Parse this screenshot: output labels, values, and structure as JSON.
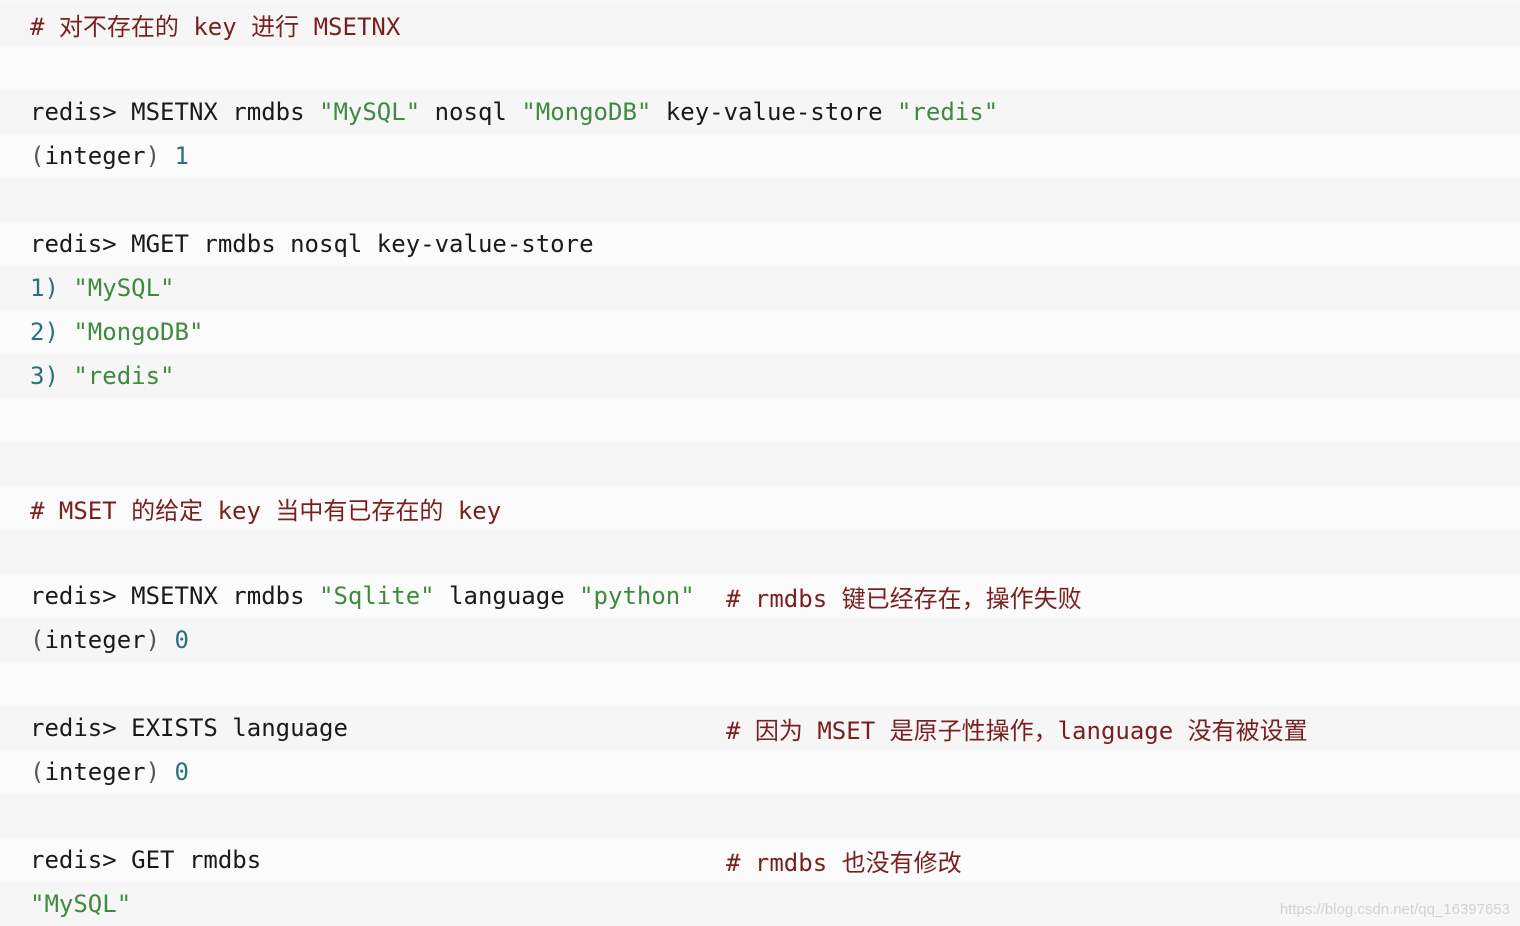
{
  "lines": {
    "l0": {
      "comment": "# 对不存在的 key 进行 MSETNX"
    },
    "l2": {
      "prompt": "redis> ",
      "cmd": "MSETNX rmdbs ",
      "s1": "\"MySQL\"",
      "m1": " nosql ",
      "s2": "\"MongoDB\"",
      "m2": " key-value-store ",
      "s3": "\"redis\""
    },
    "l3": {
      "lp": "(",
      "word": "integer",
      "rp": ")",
      "sp": " ",
      "num": "1"
    },
    "l5": {
      "prompt": "redis> ",
      "cmd": "MGET rmdbs nosql key-value-store"
    },
    "l6": {
      "idx": "1)",
      "sp": " ",
      "str": "\"MySQL\""
    },
    "l7": {
      "idx": "2)",
      "sp": " ",
      "str": "\"MongoDB\""
    },
    "l8": {
      "idx": "3)",
      "sp": " ",
      "str": "\"redis\""
    },
    "l11": {
      "comment": "# MSET 的给定 key 当中有已存在的 key"
    },
    "l13": {
      "prompt": "redis> ",
      "cmd": "MSETNX rmdbs ",
      "s1": "\"Sqlite\"",
      "m1": " language ",
      "s2": "\"python\"",
      "comment": "# rmdbs 键已经存在，操作失败"
    },
    "l14": {
      "lp": "(",
      "word": "integer",
      "rp": ")",
      "sp": " ",
      "num": "0"
    },
    "l16": {
      "prompt": "redis> ",
      "cmd": "EXISTS language",
      "comment": "# 因为 MSET 是原子性操作，language 没有被设置"
    },
    "l17": {
      "lp": "(",
      "word": "integer",
      "rp": ")",
      "sp": " ",
      "num": "0"
    },
    "l19": {
      "prompt": "redis> ",
      "cmd": "GET rmdbs",
      "comment": "# rmdbs 也没有修改"
    },
    "l20": {
      "str": "\"MySQL\""
    }
  },
  "watermark": "https://blog.csdn.net/qq_16397653",
  "colors": {
    "comment": "#7a1f1f",
    "string": "#3f8a3f",
    "number": "#2b6f7a",
    "text": "#1a1a1a",
    "background": "#f8f8f8"
  }
}
